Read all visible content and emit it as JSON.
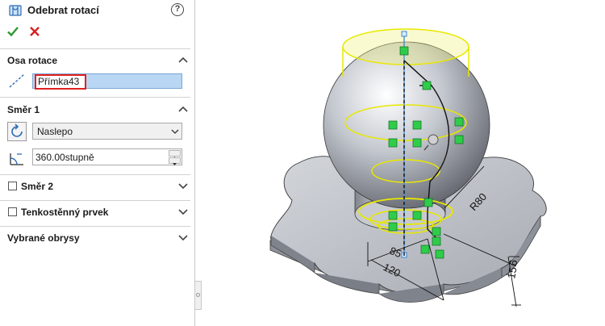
{
  "panel": {
    "title": "Odebrat rotací",
    "help_symbol": "?",
    "icons": {
      "feature": "revolve-cut-icon",
      "ok": "check-icon",
      "cancel": "close-icon",
      "help": "help-icon"
    },
    "colors": {
      "ok": "#2e9a2e",
      "cancel": "#d62020",
      "highlight_border": "#e02020",
      "field_bg": "#b9d7f3"
    }
  },
  "sections": {
    "axis": {
      "title": "Osa rotace",
      "value": "Přímka43",
      "expanded": true
    },
    "direction1": {
      "title": "Směr 1",
      "type_value": "Naslepo",
      "angle_value": "360.00stupně",
      "expanded": true
    },
    "direction2": {
      "title": "Směr 2",
      "checked": false,
      "expanded": false
    },
    "thin": {
      "title": "Tenkostěnný prvek",
      "checked": false,
      "expanded": false
    },
    "contours": {
      "title": "Vybrané obrysy",
      "expanded": false
    }
  },
  "viewport": {
    "dimensions": [
      {
        "text": "R80"
      },
      {
        "text": "85"
      },
      {
        "text": "120"
      },
      {
        "text": "15"
      },
      {
        "text": "6"
      }
    ],
    "colors": {
      "sketch": "#e8e800",
      "handle": "#2fcc4a",
      "axis": "#3a86d6",
      "part": "#b8bcc4"
    }
  }
}
